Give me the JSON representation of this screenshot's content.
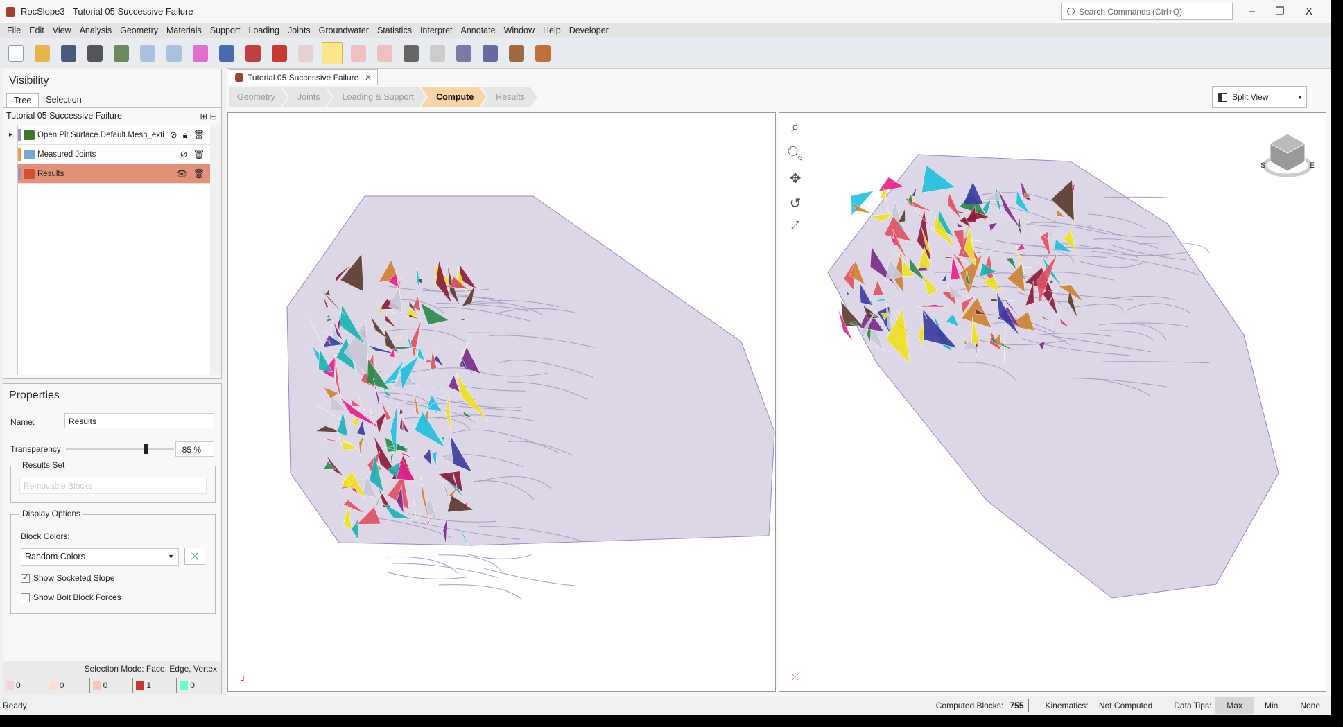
{
  "window": {
    "title": "RocSlope3 - Tutorial 05 Successive Failure",
    "search_placeholder": "Search Commands (Ctrl+Q)",
    "minimize": "–",
    "restore": "❐",
    "close": "X"
  },
  "menu": [
    "File",
    "Edit",
    "View",
    "Analysis",
    "Geometry",
    "Materials",
    "Support",
    "Loading",
    "Joints",
    "Groundwater",
    "Statistics",
    "Interpret",
    "Annotate",
    "Window",
    "Help",
    "Developer"
  ],
  "toolbar": [
    {
      "icon": "new-file-icon",
      "color": "#ffffff"
    },
    {
      "icon": "open-folder-icon",
      "color": "#e8b54c"
    },
    {
      "icon": "save-icon",
      "color": "#4a5a7a"
    },
    {
      "icon": "print-icon",
      "color": "#555555"
    },
    {
      "icon": "report-icon",
      "color": "#6a8a5a"
    },
    {
      "icon": "undo-icon",
      "color": "#a9c2e0"
    },
    {
      "icon": "redo-icon",
      "color": "#a9c2e0"
    },
    {
      "icon": "color-wheel-icon",
      "color": "#e06fd0"
    },
    {
      "icon": "image-icon",
      "color": "#4a6bb0"
    },
    {
      "icon": "edit-tool-icon",
      "color": "#c04040"
    },
    {
      "icon": "block-icon",
      "color": "#c83a30"
    },
    {
      "icon": "wireframe-block-icon",
      "color": "#e8d0d0"
    },
    {
      "icon": "select-box-icon",
      "color": "#fde58a",
      "active": true
    },
    {
      "icon": "select-lock-icon",
      "color": "#f0c0c0"
    },
    {
      "icon": "deselect-icon",
      "color": "#f0c0c0"
    },
    {
      "icon": "pen-tool-icon",
      "color": "#666666"
    },
    {
      "icon": "surface-icon",
      "color": "#cccccc"
    },
    {
      "icon": "shapes-icon",
      "color": "#7a7aaa"
    },
    {
      "icon": "import-icon",
      "color": "#6a6aa0"
    },
    {
      "icon": "table-icon",
      "color": "#a06a40"
    },
    {
      "icon": "table-export-icon",
      "color": "#c0703a"
    }
  ],
  "visibility": {
    "title": "Visibility",
    "tabs": [
      "Tree",
      "Selection"
    ],
    "project": "Tutorial 05 Successive Failure",
    "items": [
      {
        "label": "Open Pit Surface.Default.Mesh_exti",
        "bar": "#a48cc4",
        "icon": "#3f7a2a",
        "visible": false,
        "locked": true
      },
      {
        "label": "Measured Joints",
        "bar": "#f0a040",
        "icon": "#7aa6d6",
        "visible": false,
        "locked": false
      },
      {
        "label": "Results",
        "bar": "#a48cc4",
        "icon": "#d05030",
        "visible": true,
        "locked": false,
        "selected": true
      }
    ]
  },
  "properties": {
    "title": "Properties",
    "name_label": "Name:",
    "name_value": "Results",
    "transparency_label": "Transparency:",
    "transparency_value": "85 %",
    "transparency_percent": 85,
    "results_set_label": "Results Set",
    "results_set_value": "Removable Blocks",
    "display_options_label": "Display Options",
    "block_colors_label": "Block Colors:",
    "block_colors_value": "Random Colors",
    "show_socketed_slope": "Show Socketed Slope",
    "show_socketed_checked": true,
    "show_bolt_forces": "Show Bolt Block Forces",
    "show_bolt_checked": false,
    "selection_mode": "Selection Mode: Face, Edge, Vertex",
    "counts": [
      "0",
      "0",
      "0",
      "1",
      "0"
    ]
  },
  "document": {
    "tab": "Tutorial 05 Successive Failure",
    "close": "✕",
    "workflow": [
      "Geometry",
      "Joints",
      "Loading & Support",
      "Compute",
      "Results"
    ],
    "active_step": "Compute",
    "view_mode": "Split View"
  },
  "viewcube": {
    "labels": [
      "S",
      "E"
    ]
  },
  "status": {
    "ready": "Ready",
    "computed_label": "Computed Blocks:",
    "computed_value": "755",
    "kinematics_label": "Kinematics:",
    "kinematics_value": "Not Computed",
    "datatips_label": "Data Tips:",
    "datatips": [
      "Max",
      "Min",
      "None"
    ],
    "datatips_active": "Max"
  }
}
